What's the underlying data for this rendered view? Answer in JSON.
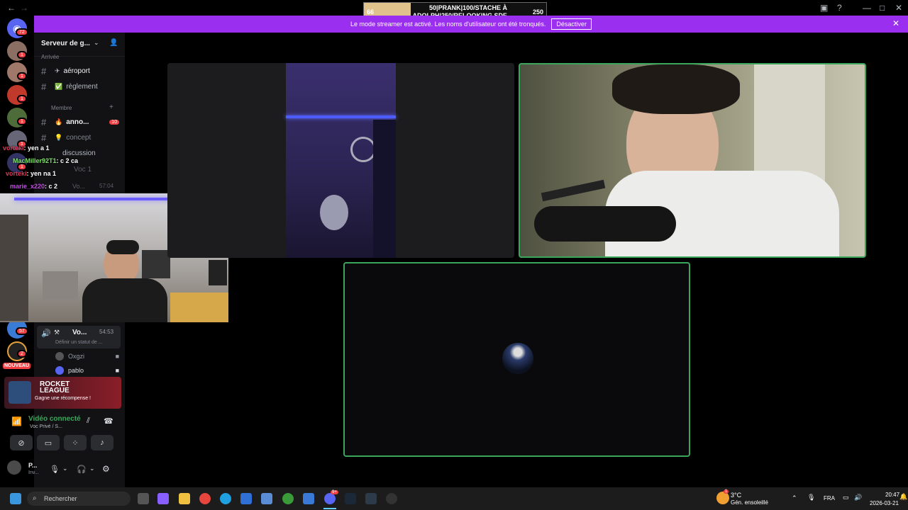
{
  "window": {
    "back_icon": "arrow-left-icon",
    "forward_icon": "arrow-right-icon"
  },
  "overlay": {
    "left_value": "66",
    "line1": "50|PRANK|100/STACHE À",
    "line2": "ADOLPH|250/RELOOKING SDF",
    "right_value": "250"
  },
  "banner": {
    "text": "Le mode streamer est activé. Les noms d'utilisateur ont été tronqués.",
    "button": "Désactiver"
  },
  "rail": {
    "home_badge": "72",
    "servers": [
      {
        "badge": "1"
      },
      {
        "badge": "1"
      },
      {
        "badge": "1"
      },
      {
        "badge": "1"
      },
      {
        "badge": "1"
      },
      {
        "badge": "1"
      },
      {
        "badge": "1"
      },
      {
        "badge": "1"
      },
      {
        "badge": "1"
      }
    ],
    "lower_badges": [
      "57",
      "2"
    ],
    "new_label": "NOUVEAU"
  },
  "sidebar": {
    "server_name": "Serveur de g...",
    "category_arrival": "Arrivée",
    "channels_top": [
      {
        "emoji": "✈",
        "name": "aéroport"
      },
      {
        "emoji": "✅",
        "name": "règlement"
      }
    ],
    "category_member": "Membre",
    "channels_member": [
      {
        "emoji": "🔥",
        "name": "anno...",
        "badge": "10"
      },
      {
        "emoji": "💡",
        "name": "concept"
      },
      {
        "emoji": "",
        "name": "discussion"
      }
    ],
    "voice_partial": "Voc 1",
    "voice_partial2": "Vo...",
    "voice_partial2_time": "57:04",
    "voice_channel": {
      "name": "Vo...",
      "time": "54:53",
      "status": "Définir un statut de ..."
    },
    "voice_users": [
      {
        "name": "Oxgzi"
      },
      {
        "name": "pablo"
      }
    ]
  },
  "chat_overlay": [
    {
      "user": "vorteki",
      "msg": ": yen a 1",
      "color": "#e5345a"
    },
    {
      "user": "MacMiller92T1",
      "msg": ": c 2 ca",
      "color": "#7ee06a"
    },
    {
      "user": "vorteki",
      "msg": ": yen na 1",
      "color": "#e5345a"
    },
    {
      "user": "marie_x220",
      "msg": ": c 2",
      "color": "#c04ee0"
    }
  ],
  "promo": {
    "title_line1": "ROCKET",
    "title_line2": "LEAGUE",
    "subtitle": "Gagne une récompense !"
  },
  "voice_status": {
    "title": "Vidéo connecté",
    "subtitle": "Voc Privé / S..."
  },
  "user_panel": {
    "name": "P...",
    "status": "Inv..."
  },
  "taskbar": {
    "search_placeholder": "Rechercher",
    "discord_badge": "9+",
    "weather_temp": "3°C",
    "weather_desc": "Gén. ensoleillé",
    "weather_badge": "1",
    "lang": "FRA",
    "time": "20:47",
    "date": "2026-03-21"
  },
  "colors": {
    "banner": "#9b2ff0",
    "speaking_border": "#3ba55c",
    "badge": "#f23f43"
  }
}
